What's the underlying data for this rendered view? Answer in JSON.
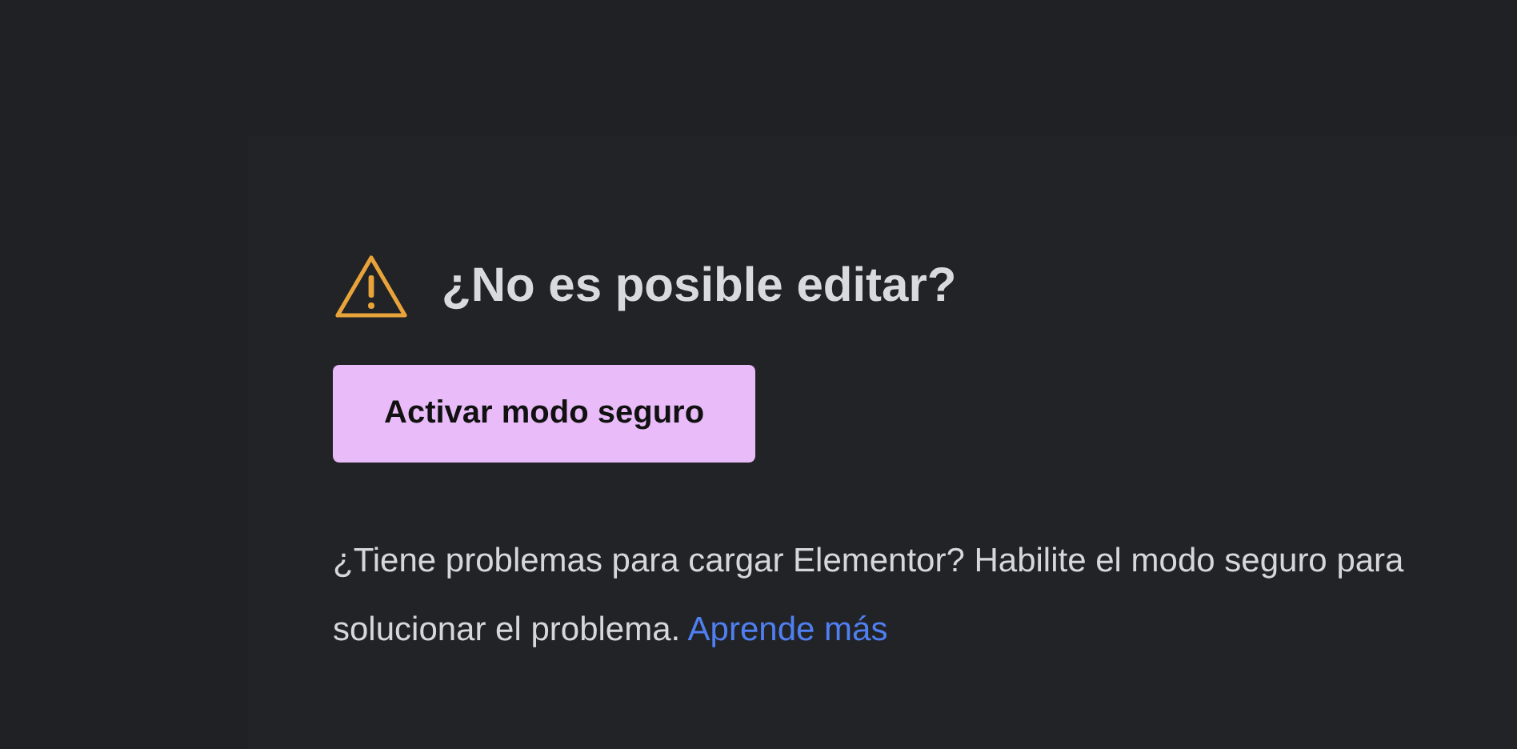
{
  "notice": {
    "title": "¿No es posible editar?",
    "button": "Activar modo seguro",
    "message": "¿Tiene problemas para cargar Elementor? Habilite el modo seguro para solucionar el problema.",
    "link": "Aprende más"
  }
}
